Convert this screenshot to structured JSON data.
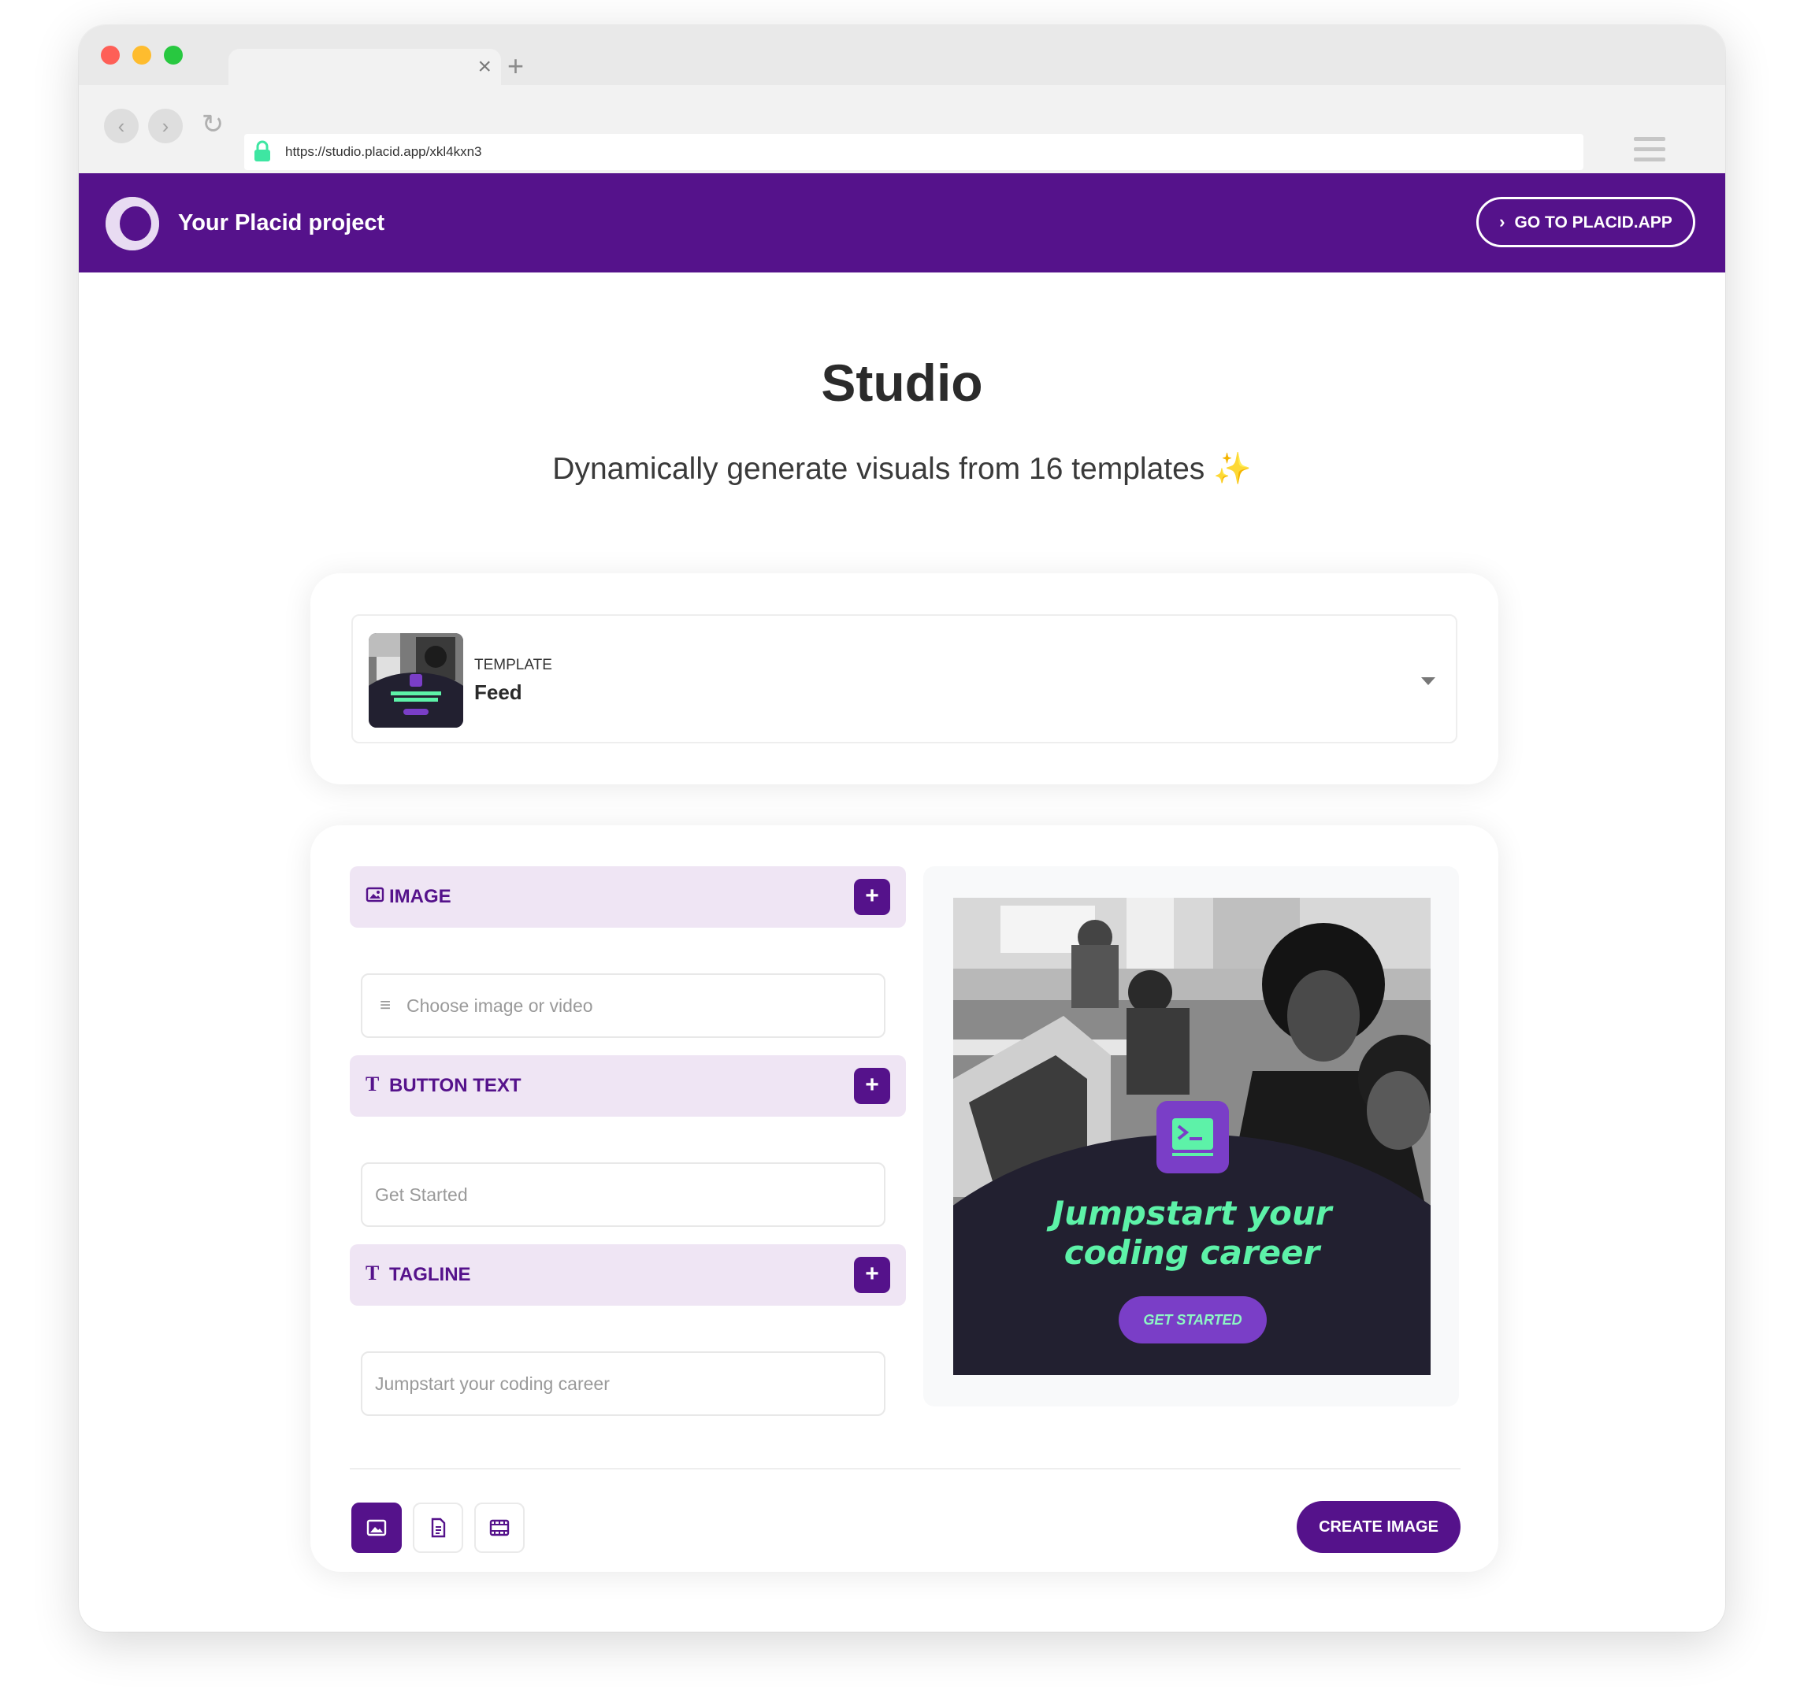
{
  "browser": {
    "url": "https://studio.placid.app/xkl4kxn3",
    "tab_close": "×",
    "new_tab": "+"
  },
  "header": {
    "brand": "Your Placid project",
    "goto_button": "GO TO PLACID.APP",
    "brand_color": "#55128b"
  },
  "page": {
    "title": "Studio",
    "subtitle": "Dynamically generate visuals from 16 templates",
    "subtitle_emoji": "✨"
  },
  "template": {
    "label": "TEMPLATE",
    "name": "Feed"
  },
  "fields": {
    "image": {
      "title": "IMAGE",
      "placeholder": "Choose image or video",
      "icon": "image-icon"
    },
    "button_text": {
      "title": "BUTTON TEXT",
      "value": "Get Started",
      "icon": "text-icon"
    },
    "tagline": {
      "title": "TAGLINE",
      "value": "Jumpstart your coding career",
      "icon": "text-icon"
    },
    "add_label": "+"
  },
  "preview": {
    "headline_line1": "Jumpstart your",
    "headline_line2": "coding career",
    "button": "GET STARTED",
    "accent": "#5df2a8",
    "button_color": "#7a3ec7"
  },
  "footer": {
    "output_types": [
      "image",
      "pdf",
      "video"
    ],
    "active_output": "image",
    "create_button": "CREATE IMAGE"
  }
}
